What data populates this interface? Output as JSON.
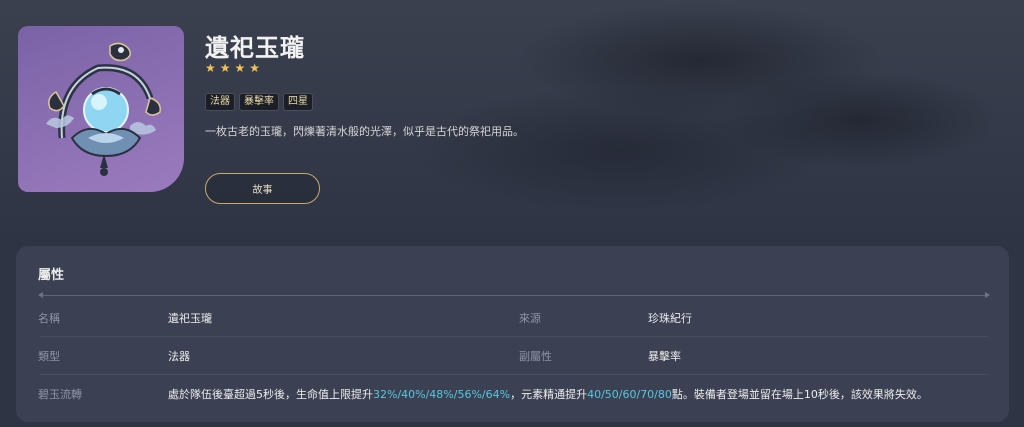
{
  "item": {
    "name": "遺祀玉瓏",
    "rarity": 4,
    "tags": [
      "法器",
      "暴擊率",
      "四星"
    ],
    "description": "一枚古老的玉瓏，閃爍著清水般的光澤，似乎是古代的祭祀用品。",
    "story_button": "故事"
  },
  "attributes": {
    "title": "屬性",
    "rows": [
      {
        "l1": "名稱",
        "v1": "遺祀玉瓏",
        "l2": "來源",
        "v2": "珍珠紀行"
      },
      {
        "l1": "類型",
        "v1": "法器",
        "l2": "副屬性",
        "v2": "暴擊率"
      }
    ],
    "passive": {
      "label": "碧玉流轉",
      "p1": "處於隊伍後臺超過5秒後，生命值上限提升",
      "hp": "32%/40%/48%/56%/64%",
      "p2": "，元素精通提升",
      "em": "40/50/60/70/80",
      "p3": "點。裝備者登場並留在場上10秒後，該效果將失效。"
    }
  },
  "colors": {
    "accent": "#56c7e0",
    "star": "#f0c35a",
    "card": "#8d70b4"
  },
  "icons": {
    "star": "star-icon",
    "artwork": "jadefall-splendor-art"
  }
}
